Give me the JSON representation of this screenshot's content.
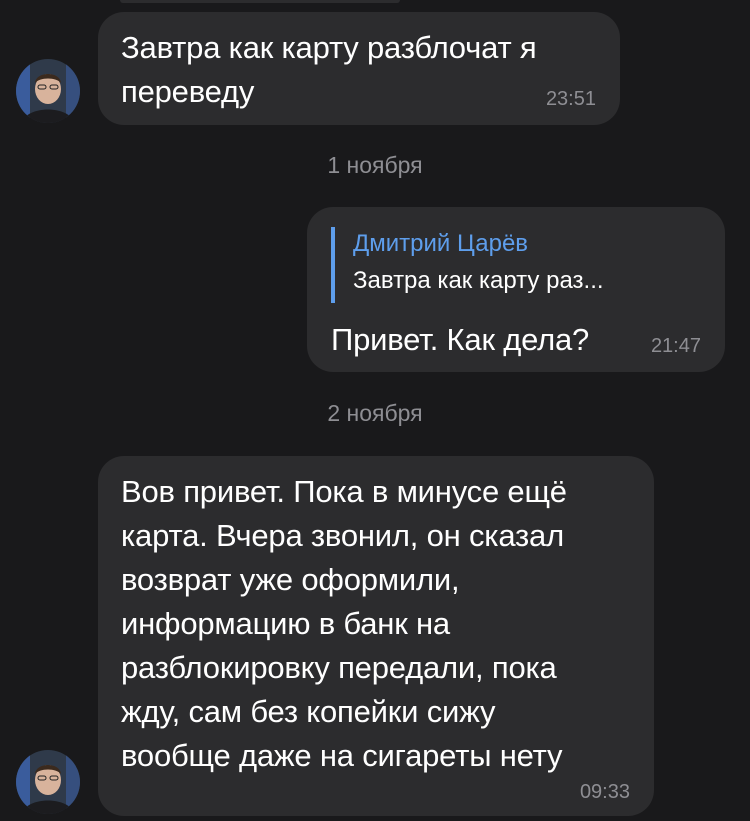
{
  "messages": [
    {
      "text_lines": [
        "Завтра как карту разблочат я",
        "переведу"
      ],
      "time": "23:51"
    },
    {
      "reply_author": "Дмитрий Царёв",
      "reply_quote": "Завтра как карту раз...",
      "text": "Привет. Как дела?",
      "time": "21:47"
    },
    {
      "text_lines": [
        "Вов привет. Пока в минусе ещё",
        "карта. Вчера звонил, он сказал",
        "возврат уже оформили,",
        "информацию в банк на",
        "разблокировку передали, пока",
        "жду, сам без копейки сижу",
        "вообще даже на сигареты нету"
      ],
      "time": "09:33"
    }
  ],
  "dates": [
    "1 ноября",
    "2 ноября"
  ],
  "colors": {
    "background": "#19191b",
    "bubble": "#2c2c2e",
    "accent": "#5e9eec",
    "secondary_text": "#8e8e93"
  }
}
